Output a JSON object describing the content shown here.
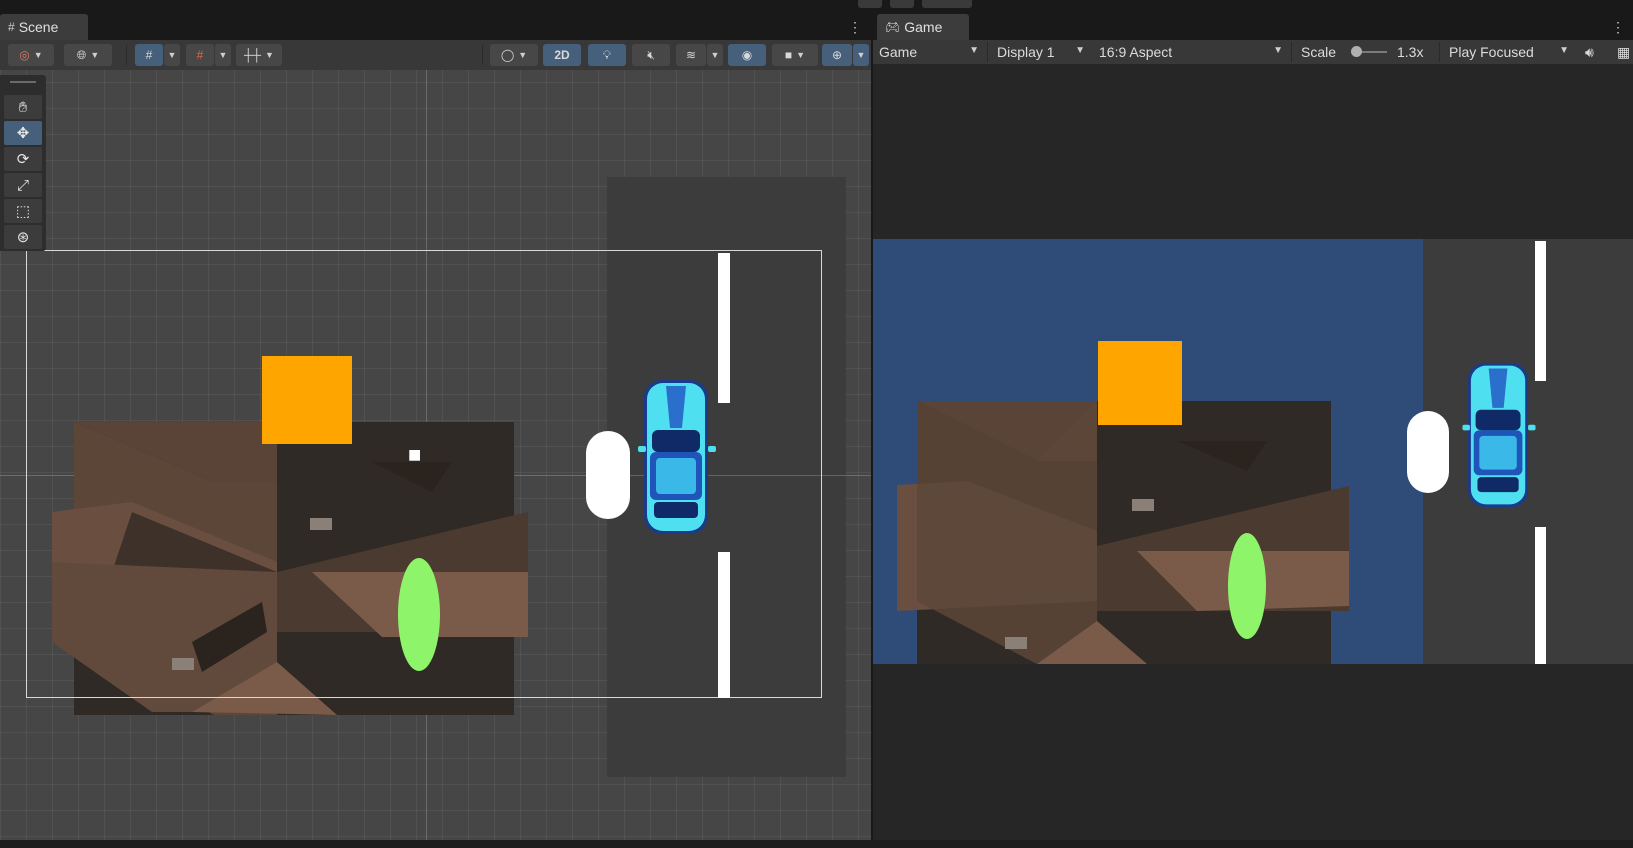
{
  "scene_panel": {
    "tab_label": "Scene",
    "toolbar": {
      "two_d_label": "2D"
    },
    "tools": [
      "hand-tool",
      "move-tool",
      "rotate-tool",
      "scale-tool",
      "rect-tool",
      "transform-tool"
    ]
  },
  "game_panel": {
    "tab_label": "Game",
    "toolbar": {
      "mode_value": "Game",
      "display_value": "Display 1",
      "aspect_value": "16:9 Aspect",
      "scale_label": "Scale",
      "scale_value": "1.3x",
      "play_focus_value": "Play Focused"
    }
  },
  "colors": {
    "accent_on": "#46607c",
    "orange_box": "#ffa500",
    "green_ellipse": "#8ef56a",
    "car": "#4ee0f0",
    "road": "#3a3a3a",
    "sky_bg": "#2f4b78",
    "roof": "#6b4f3e"
  }
}
